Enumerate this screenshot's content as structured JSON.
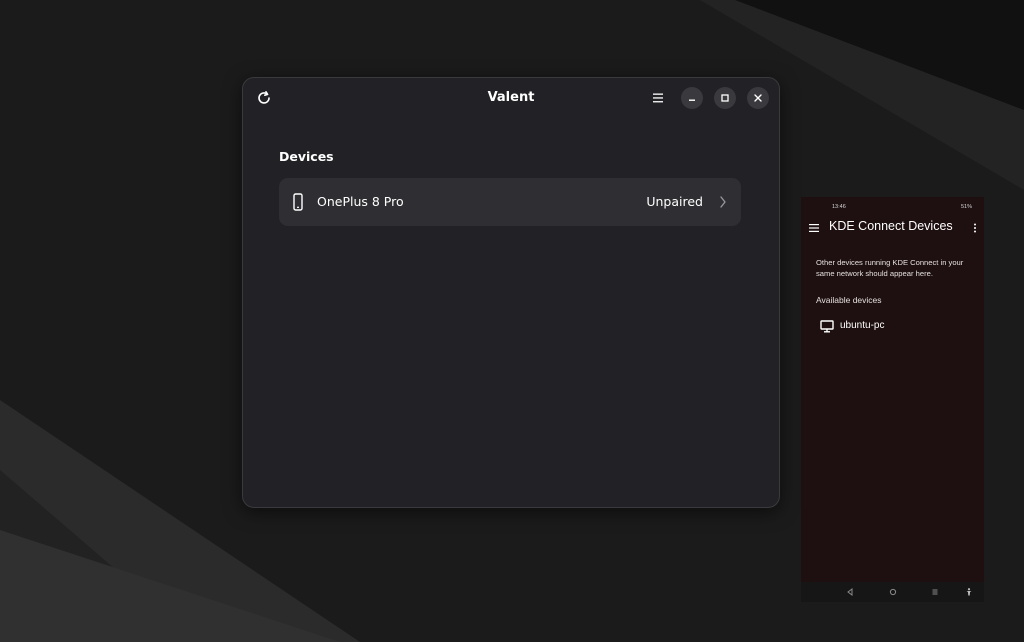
{
  "valent": {
    "title": "Valent",
    "section_title": "Devices",
    "devices": [
      {
        "name": "OnePlus 8 Pro",
        "status": "Unpaired"
      }
    ]
  },
  "phone": {
    "status_time": "13:46",
    "status_battery": "51%",
    "app_title": "KDE Connect Devices",
    "info_text": "Other devices running KDE Connect in your same network should appear here.",
    "available_label": "Available devices",
    "devices": [
      {
        "name": "ubuntu-pc",
        "icon": "monitor-icon"
      }
    ]
  },
  "colors": {
    "desktop": "#1c1c1c",
    "window_bg": "#222226",
    "row_bg": "#2f2f33",
    "phone_bg": "#1e1010"
  }
}
